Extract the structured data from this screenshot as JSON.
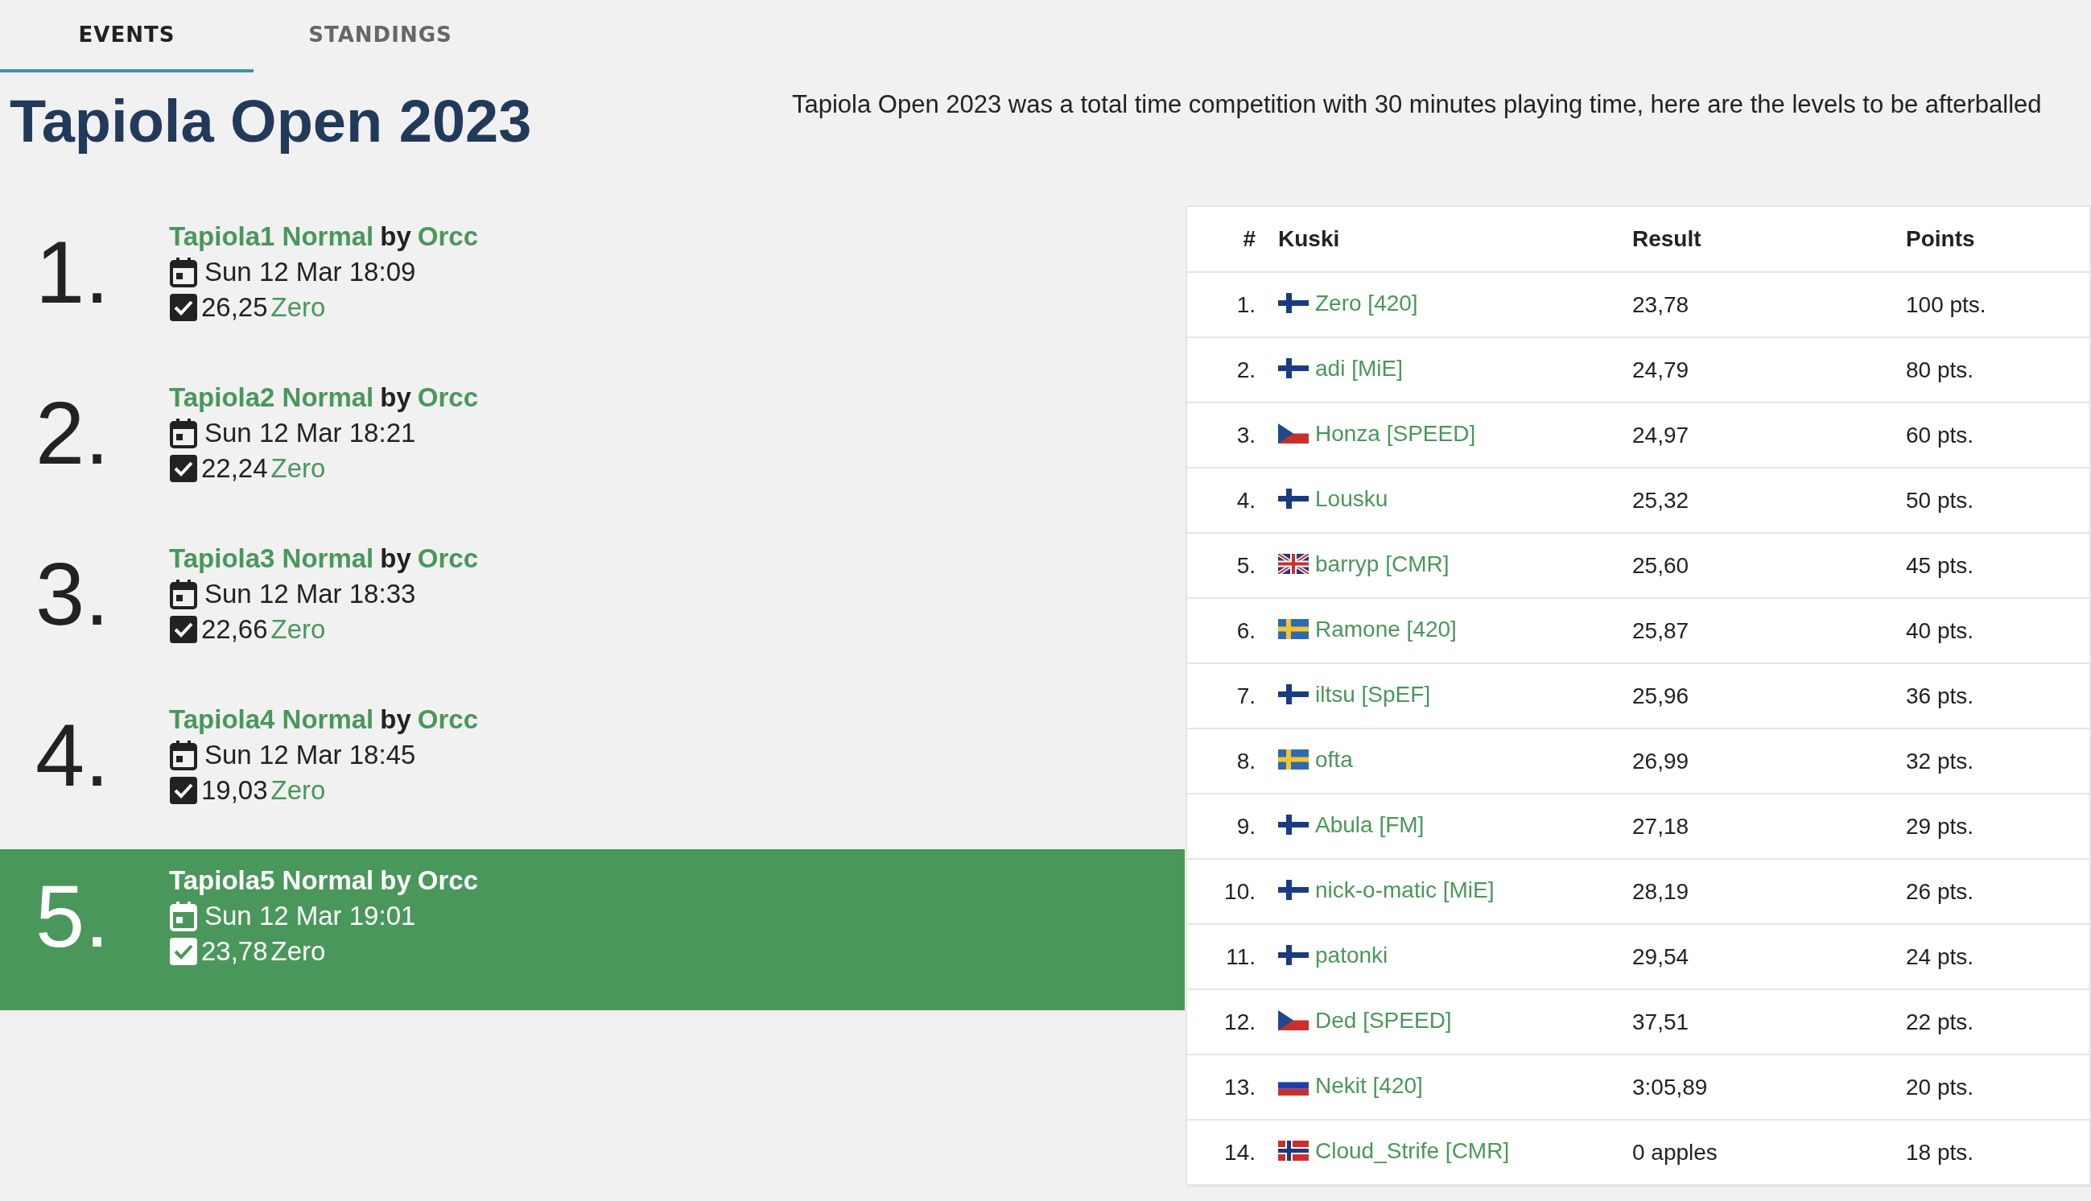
{
  "tabs": [
    {
      "label": "EVENTS",
      "selected": true
    },
    {
      "label": "STANDINGS",
      "selected": false
    }
  ],
  "title": "Tapiola Open 2023",
  "description": "Tapiola Open 2023 was a total time competition with 30 minutes playing time, here are the levels to be afterballed",
  "events": [
    {
      "number": "1.",
      "level": "Tapiola1 Normal",
      "by": "by",
      "author": "Orcc",
      "date": "Sun 12 Mar 18:09",
      "time": "26,25",
      "winner": "Zero",
      "selected": false
    },
    {
      "number": "2.",
      "level": "Tapiola2 Normal",
      "by": "by",
      "author": "Orcc",
      "date": "Sun 12 Mar 18:21",
      "time": "22,24",
      "winner": "Zero",
      "selected": false
    },
    {
      "number": "3.",
      "level": "Tapiola3 Normal",
      "by": "by",
      "author": "Orcc",
      "date": "Sun 12 Mar 18:33",
      "time": "22,66",
      "winner": "Zero",
      "selected": false
    },
    {
      "number": "4.",
      "level": "Tapiola4 Normal",
      "by": "by",
      "author": "Orcc",
      "date": "Sun 12 Mar 18:45",
      "time": "19,03",
      "winner": "Zero",
      "selected": false
    },
    {
      "number": "5.",
      "level": "Tapiola5 Normal",
      "by": "by",
      "author": "Orcc",
      "date": "Sun 12 Mar 19:01",
      "time": "23,78",
      "winner": "Zero",
      "selected": true
    }
  ],
  "table": {
    "columns": [
      "#",
      "Kuski",
      "Result",
      "Points"
    ],
    "rows": [
      {
        "rank": "1.",
        "kind": "fi",
        "kuski": "Zero [420]",
        "result": "23,78",
        "points": "100 pts."
      },
      {
        "rank": "2.",
        "kind": "fi",
        "kuski": "adi [MiE]",
        "result": "24,79",
        "points": "80 pts."
      },
      {
        "rank": "3.",
        "kind": "cz",
        "kuski": "Honza [SPEED]",
        "result": "24,97",
        "points": "60 pts."
      },
      {
        "rank": "4.",
        "kind": "fi",
        "kuski": "Lousku",
        "result": "25,32",
        "points": "50 pts."
      },
      {
        "rank": "5.",
        "kind": "gb",
        "kuski": "barryp [CMR]",
        "result": "25,60",
        "points": "45 pts."
      },
      {
        "rank": "6.",
        "kind": "se",
        "kuski": "Ramone [420]",
        "result": "25,87",
        "points": "40 pts."
      },
      {
        "rank": "7.",
        "kind": "fi",
        "kuski": "iltsu [SpEF]",
        "result": "25,96",
        "points": "36 pts."
      },
      {
        "rank": "8.",
        "kind": "se",
        "kuski": "ofta",
        "result": "26,99",
        "points": "32 pts."
      },
      {
        "rank": "9.",
        "kind": "fi",
        "kuski": "Abula [FM]",
        "result": "27,18",
        "points": "29 pts."
      },
      {
        "rank": "10.",
        "kind": "fi",
        "kuski": "nick-o-matic [MiE]",
        "result": "28,19",
        "points": "26 pts."
      },
      {
        "rank": "11.",
        "kind": "fi",
        "kuski": "patonki",
        "result": "29,54",
        "points": "24 pts."
      },
      {
        "rank": "12.",
        "kind": "cz",
        "kuski": "Ded [SPEED]",
        "result": "37,51",
        "points": "22 pts."
      },
      {
        "rank": "13.",
        "kind": "ru",
        "kuski": "Nekit [420]",
        "result": "3:05,89",
        "points": "20 pts."
      },
      {
        "rank": "14.",
        "kind": "no",
        "kuski": "Cloud_Strife [CMR]",
        "result": "0 apples",
        "points": "18 pts."
      }
    ]
  }
}
